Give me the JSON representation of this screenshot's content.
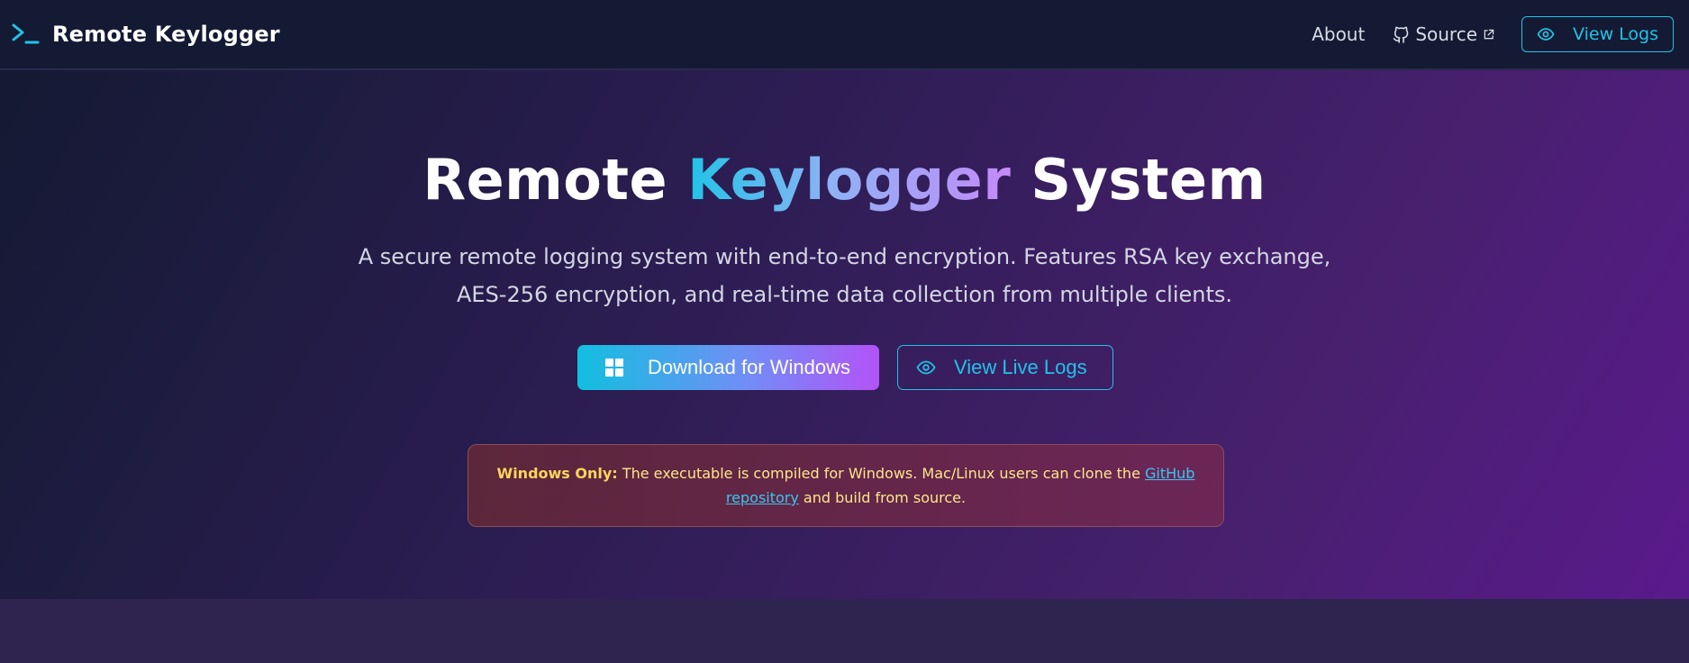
{
  "navbar": {
    "brand_title": "Remote Keylogger",
    "brand_icon": "terminal-prompt-icon",
    "about_label": "About",
    "source_label": "Source",
    "view_logs_label": "View Logs"
  },
  "hero": {
    "title_part1": "Remote ",
    "title_highlight": "Keylogger",
    "title_part2": " System",
    "description": "A secure remote logging system with end-to-end encryption. Features RSA key exchange, AES-256 encryption, and real-time data collection from multiple clients.",
    "download_label": "Download for Windows",
    "live_logs_label": "View Live Logs"
  },
  "notice": {
    "strong_label": "Windows Only:",
    "text_before_link": " The executable is compiled for Windows. Mac/Linux users can clone the ",
    "link_text": "GitHub repository",
    "text_after_link": " and build from source."
  },
  "colors": {
    "accent": "#22c3e6",
    "purple": "#b353f7",
    "warning_text": "#fde68a"
  }
}
